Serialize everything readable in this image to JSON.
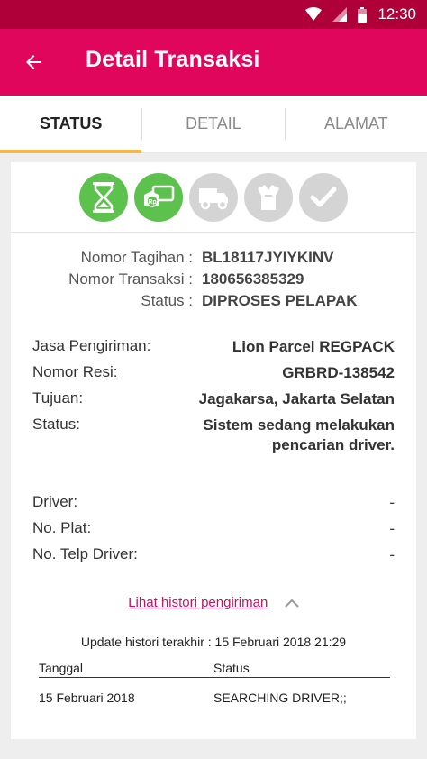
{
  "status_bar": {
    "time": "12:30"
  },
  "appbar": {
    "title": "Detail Transaksi"
  },
  "tabs": [
    {
      "label": "STATUS",
      "active": true
    },
    {
      "label": "DETAIL",
      "active": false
    },
    {
      "label": "ALAMAT",
      "active": false
    }
  ],
  "progress_steps": [
    {
      "icon": "hourglass-icon",
      "state": "done"
    },
    {
      "icon": "payment-icon",
      "state": "done"
    },
    {
      "icon": "truck-icon",
      "state": "todo"
    },
    {
      "icon": "package-icon",
      "state": "todo"
    },
    {
      "icon": "check-icon",
      "state": "todo"
    }
  ],
  "colors": {
    "accent": "#e0065b",
    "statusbar": "#b0003a",
    "tab_indicator": "#f6b945",
    "step_done": "#5cc24d",
    "step_todo": "#d4d4d4",
    "link": "#c21560"
  },
  "summary": {
    "nomor_tagihan_label": "Nomor Tagihan :",
    "nomor_tagihan": "BL18117JYIYKINV",
    "nomor_transaksi_label": "Nomor Transaksi :",
    "nomor_transaksi": "180656385329",
    "status_label": "Status :",
    "status": "DIPROSES PELAPAK"
  },
  "shipping": {
    "jasa_label": "Jasa Pengiriman:",
    "jasa": "Lion Parcel REGPACK",
    "resi_label": "Nomor Resi:",
    "resi": "GRBRD-138542",
    "tujuan_label": "Tujuan:",
    "tujuan": "Jagakarsa, Jakarta Selatan",
    "status_label": "Status:",
    "status_line1": "Sistem sedang melakukan",
    "status_line2": "pencarian driver."
  },
  "driver": {
    "driver_label": "Driver:",
    "driver": "-",
    "plat_label": "No. Plat:",
    "plat": "-",
    "telp_label": "No. Telp Driver:",
    "telp": "-"
  },
  "history": {
    "link_label": "Lihat histori pengiriman",
    "update_text": "Update histori terakhir : 15 Februari 2018 21:29",
    "col_date": "Tanggal",
    "col_status": "Status",
    "rows": [
      {
        "date": "15 Februari 2018",
        "status": "SEARCHING DRIVER;;"
      }
    ]
  }
}
